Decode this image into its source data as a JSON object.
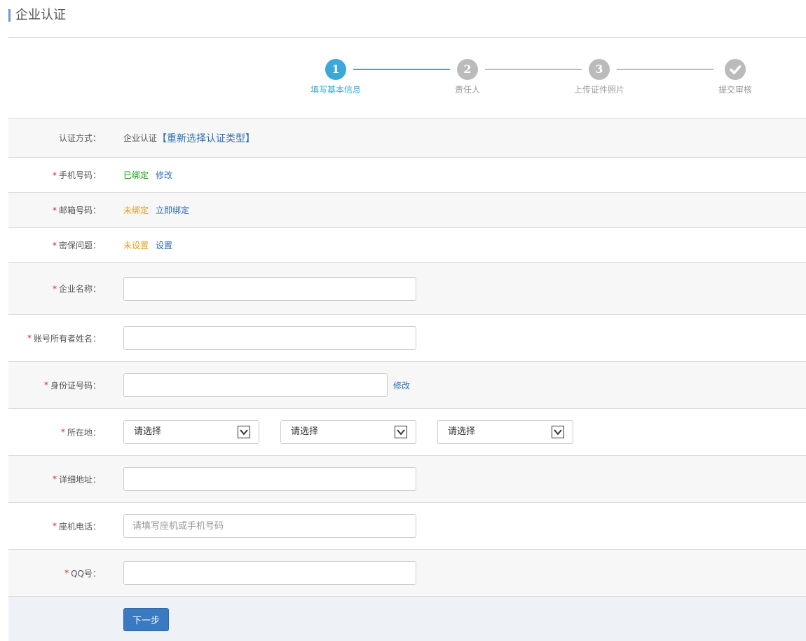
{
  "page": {
    "title": "企业认证"
  },
  "steps": [
    {
      "number": "1",
      "label": "填写基本信息",
      "state": "active"
    },
    {
      "number": "2",
      "label": "责任人",
      "state": "inactive"
    },
    {
      "number": "3",
      "label": "上传证件照片",
      "state": "inactive"
    },
    {
      "icon": "check-icon",
      "label": "提交审核",
      "state": "inactive"
    }
  ],
  "form": {
    "auth_method": {
      "label": "认证方式：",
      "value": "企业认证",
      "link": "【重新选择认证类型】"
    },
    "phone": {
      "label": "手机号码：",
      "status": "已绑定",
      "action": "修改"
    },
    "email": {
      "label": "邮箱号码：",
      "status": "未绑定",
      "action": "立即绑定"
    },
    "security": {
      "label": "密保问题：",
      "status": "未设置",
      "action": "设置"
    },
    "company_name": {
      "label": "企业名称：",
      "value": ""
    },
    "owner_name": {
      "label": "账号所有者姓名：",
      "value": ""
    },
    "id_number": {
      "label": "身份证号码：",
      "value": "",
      "action": "修改"
    },
    "location": {
      "label": "所在地：",
      "selects": [
        "请选择",
        "请选择",
        "请选择"
      ]
    },
    "address": {
      "label": "详细地址：",
      "value": ""
    },
    "telephone": {
      "label": "座机电话：",
      "value": "",
      "placeholder": "请填写座机或手机号码"
    },
    "qq": {
      "label": "QQ号：",
      "value": ""
    },
    "required_mark": "*",
    "next_button": "下一步"
  },
  "colors": {
    "accent": "#3ba8d9",
    "link": "#2f6fb0",
    "bound": "#1a9e1a",
    "unbound": "#e0a020",
    "required": "#e02020",
    "button": "#3a7ac0"
  }
}
